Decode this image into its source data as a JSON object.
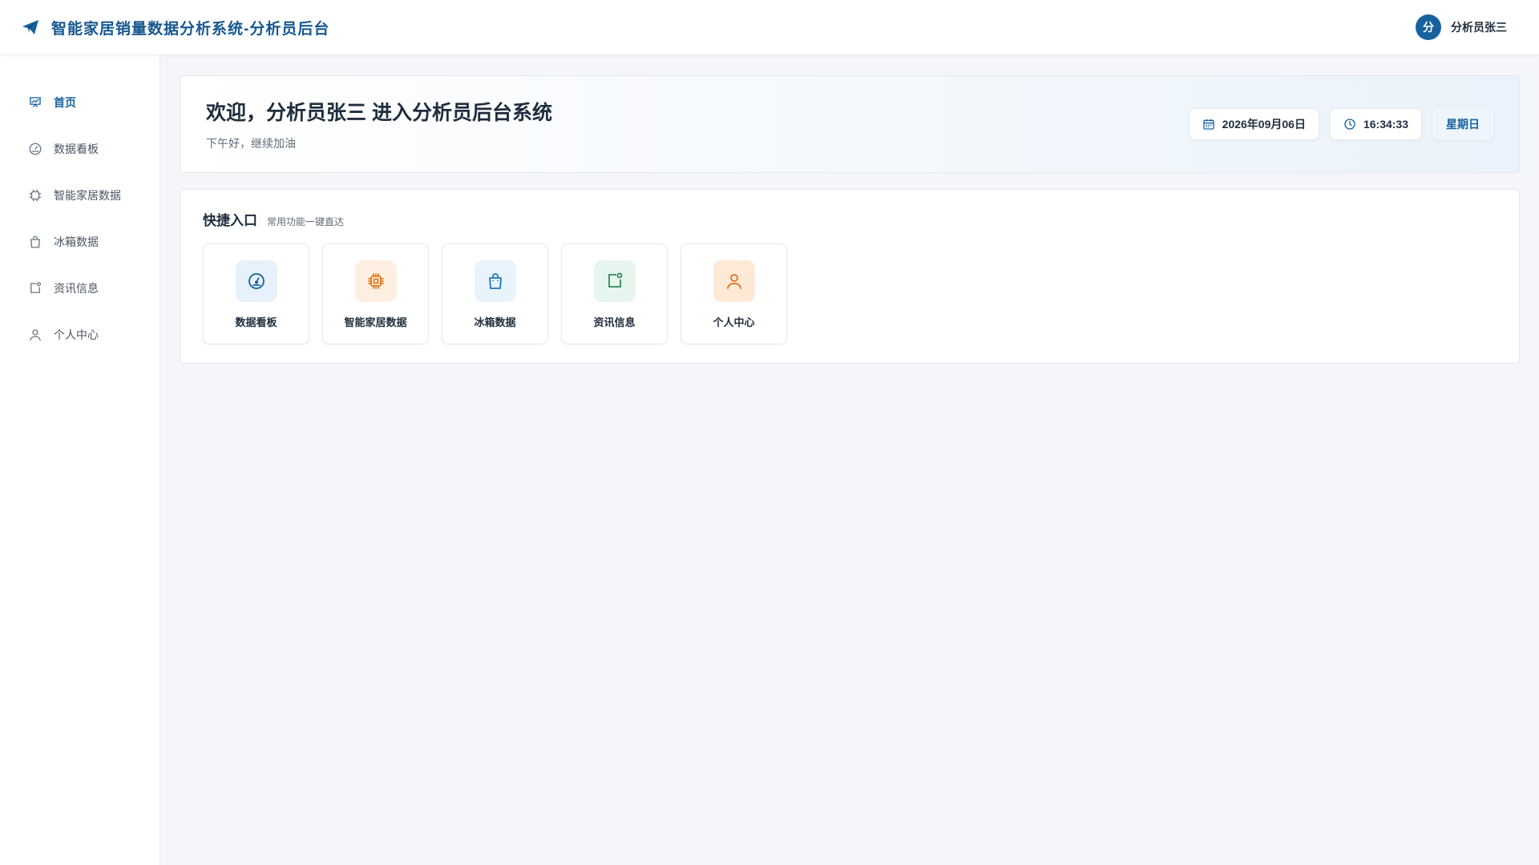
{
  "header": {
    "title": "智能家居销量数据分析系统-分析员后台",
    "logo_icon": "paper-plane-icon",
    "user": {
      "avatar_text": "分",
      "name": "分析员张三"
    }
  },
  "sidebar": {
    "items": [
      {
        "label": "首页",
        "icon": "presentation-chart-icon",
        "active": true
      },
      {
        "label": "数据看板",
        "icon": "gauge-icon",
        "active": false
      },
      {
        "label": "智能家居数据",
        "icon": "chip-icon",
        "active": false
      },
      {
        "label": "冰箱数据",
        "icon": "shopping-bag-icon",
        "active": false
      },
      {
        "label": "资讯信息",
        "icon": "notification-square-icon",
        "active": false
      },
      {
        "label": "个人中心",
        "icon": "user-icon",
        "active": false
      }
    ]
  },
  "welcome": {
    "title": "欢迎，分析员张三 进入分析员后台系统",
    "subtitle": "下午好，继续加油",
    "date": "2026年09月06日",
    "time": "16:34:33",
    "weekday": "星期日"
  },
  "quick": {
    "title": "快捷入口",
    "subtitle": "常用功能一键直达",
    "cards": [
      {
        "label": "数据看板",
        "icon": "gauge-icon",
        "bg": "#e6f1fb",
        "fg": "#17629e"
      },
      {
        "label": "智能家居数据",
        "icon": "chip-icon",
        "bg": "#fdf0e2",
        "fg": "#e07b1f"
      },
      {
        "label": "冰箱数据",
        "icon": "shopping-bag-icon",
        "bg": "#e8f3fb",
        "fg": "#1f7ab8"
      },
      {
        "label": "资讯信息",
        "icon": "notification-square-icon",
        "bg": "#e6f5ee",
        "fg": "#2e8b57"
      },
      {
        "label": "个人中心",
        "icon": "user-icon",
        "bg": "#fde9d6",
        "fg": "#d9731f"
      }
    ]
  },
  "colors": {
    "accent": "#17629e",
    "background": "#f4f6f9"
  }
}
